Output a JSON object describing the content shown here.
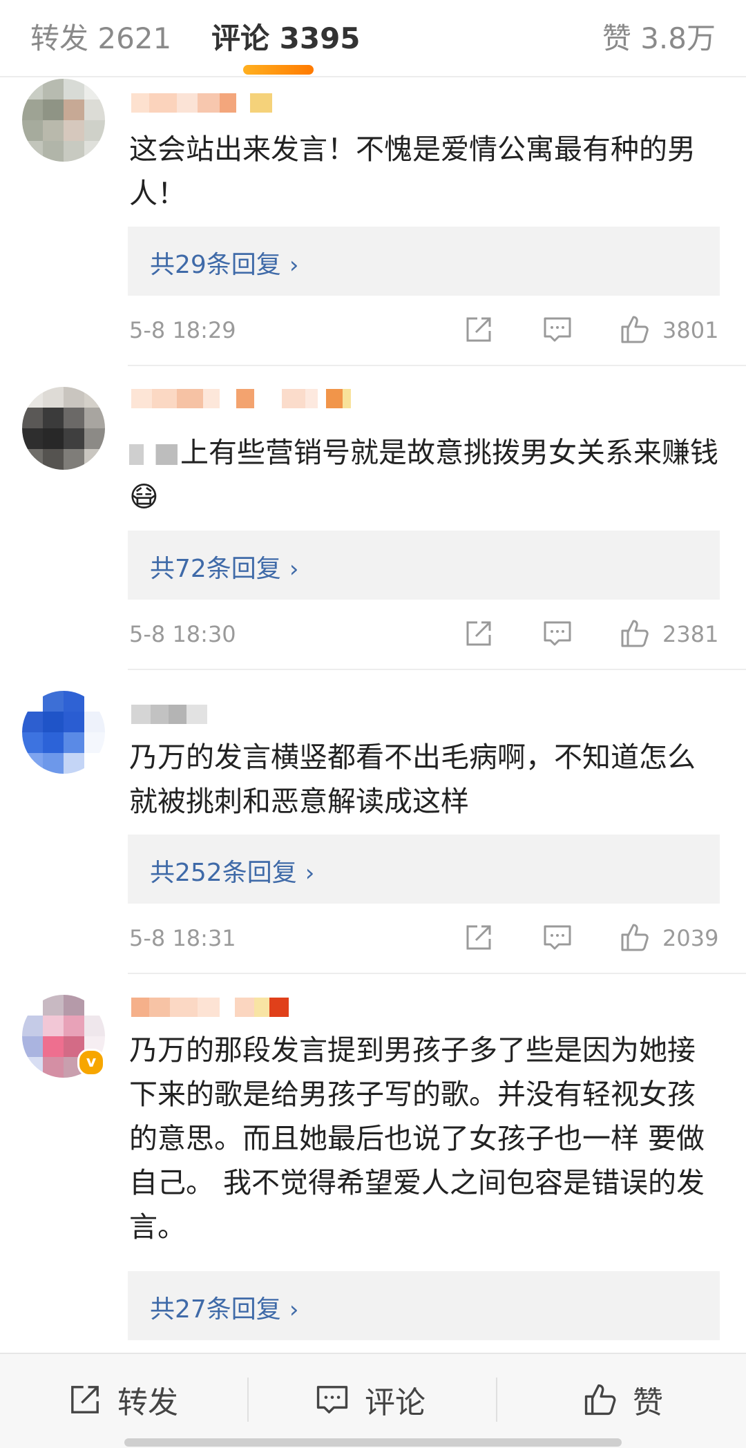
{
  "tabs": {
    "repost": "转发 2621",
    "comment": "评论 3395",
    "like": "赞 3.8万"
  },
  "comments": [
    {
      "text": "这会站出来发言！不愧是爱情公寓最有种的男人！",
      "replies": "共29条回复",
      "time": "5-8 18:29",
      "likes": "3801"
    },
    {
      "text": "上有些营销号就是故意挑拨男女关系来赚钱😷",
      "replies": "共72条回复",
      "time": "5-8 18:30",
      "likes": "2381"
    },
    {
      "text": "乃万的发言横竖都看不出毛病啊，不知道怎么就被挑刺和恶意解读成这样",
      "replies": "共252条回复",
      "time": "5-8 18:31",
      "likes": "2039"
    },
    {
      "text": "乃万的那段发言提到男孩子多了些是因为她接下来的歌是给男孩子写的歌。并没有轻视女孩的意思。而且她最后也说了女孩子也一样 要做自己。 我不觉得希望爱人之间包容是错误的发言。",
      "replies": "共27条回复",
      "badge": "v"
    }
  ],
  "bottombar": {
    "repost": "转发",
    "comment": "评论",
    "like": "赞"
  },
  "colors": {
    "link_blue": "#3f6aa8",
    "accent_orange": "#ff8a00",
    "reply_bg": "#f2f2f2"
  },
  "icons": [
    "share-icon",
    "comment-icon",
    "thumb-up-icon",
    "chevron-right-icon"
  ]
}
